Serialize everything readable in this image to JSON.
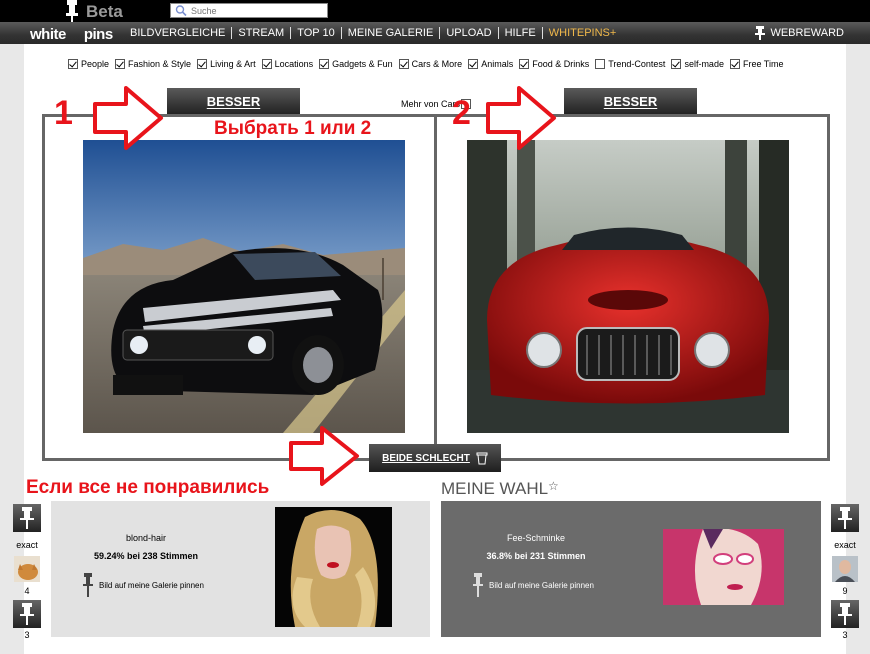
{
  "header": {
    "logo_badge": "Beta",
    "logo_word_left": "white",
    "logo_word_right": "pins",
    "search_placeholder": "Suche"
  },
  "nav": {
    "items": [
      "BILDVERGLEICHE",
      "STREAM",
      "TOP 10",
      "MEINE GALERIE",
      "UPLOAD",
      "HILFE",
      "WHITEPINS+"
    ],
    "webreward": "WEBREWARD",
    "highlight_color": "#f0b84a"
  },
  "categories": [
    {
      "label": "People",
      "checked": true
    },
    {
      "label": "Fashion & Style",
      "checked": true
    },
    {
      "label": "Living & Art",
      "checked": true
    },
    {
      "label": "Locations",
      "checked": true
    },
    {
      "label": "Gadgets & Fun",
      "checked": true
    },
    {
      "label": "Cars & More",
      "checked": true
    },
    {
      "label": "Animals",
      "checked": true
    },
    {
      "label": "Food & Drinks",
      "checked": true
    },
    {
      "label": "Trend-Contest",
      "checked": false
    },
    {
      "label": "self-made",
      "checked": true
    },
    {
      "label": "Free Time",
      "checked": true
    }
  ],
  "compare": {
    "better_left": "BESSER",
    "better_right": "BESSER",
    "more_from": "Mehr von Cars",
    "both_bad": "BEIDE SCHLECHT"
  },
  "annotations": {
    "num1": "1",
    "num2": "2",
    "choose": "Выбрать 1 или 2",
    "dislike": "Если все не понравились",
    "color": "#e8141b"
  },
  "my_choice": {
    "title": "MEINE WAHL",
    "star": "☆"
  },
  "cards": {
    "left": {
      "name": "blond-hair",
      "stats": "59.24% bei 238 Stimmen",
      "pin_label": "Bild auf meine Galerie pinnen"
    },
    "right": {
      "name": "Fee-Schminke",
      "stats": "36.8% bei 231 Stimmen",
      "pin_label": "Bild auf meine Galerie pinnen"
    }
  },
  "side_left": {
    "label": "exact",
    "count": "4",
    "count2": "3"
  },
  "side_right": {
    "label": "exact",
    "count": "9",
    "count2": "3"
  }
}
